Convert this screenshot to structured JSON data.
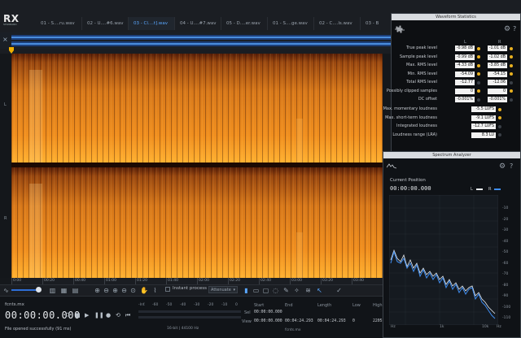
{
  "app": {
    "logo": "RX",
    "logo_sub": "STANDARD"
  },
  "tabs": [
    {
      "label": "01 - S....ru.wav",
      "active": false
    },
    {
      "label": "02 - U....#6.wav",
      "active": false
    },
    {
      "label": "03 - Cl....t].wav",
      "active": true
    },
    {
      "label": "04 - U....#7.wav",
      "active": false
    },
    {
      "label": "05 - D....er.wav",
      "active": false
    },
    {
      "label": "01 - S....ge.wav",
      "active": false
    },
    {
      "label": "02 - C....ls.wav",
      "active": false
    },
    {
      "label": "03 - B",
      "active": false
    }
  ],
  "channels": {
    "left": "L",
    "right": "R"
  },
  "timeline": [
    "0:00",
    "00:20",
    "00:40",
    "01:00",
    "01:20",
    "01:40",
    "02:00",
    "02:20",
    "02:40",
    "03:00",
    "03:20",
    "03:40"
  ],
  "toolbar": {
    "instant_process": "Instant process",
    "attenuate": "Attenuate"
  },
  "bottom": {
    "filename": "fcnts.mx",
    "timecode": "00:00:00.000",
    "status": "File opened successfully (91 ms)",
    "meter_ticks": [
      "-Inf.",
      "-60",
      "-50",
      "-40",
      "-30",
      "-20",
      "-10",
      "0"
    ],
    "bitdepth": "16-bit | 44100 Hz",
    "headers": {
      "start": "Start",
      "end": "End",
      "length": "Length",
      "low": "Low",
      "high": "High"
    },
    "sel_label": "Sel",
    "view_label": "View",
    "sel_start": "00:00:00.000",
    "view_start": "00:00:00.000",
    "view_end": "00:04:24.293",
    "view_length": "00:04:24.293",
    "low_val": "0",
    "high_val": "2205",
    "file_small": "fcnts.mx"
  },
  "waveform_statistics": {
    "title": "Waveform Statistics",
    "col_l": "L",
    "col_r": "R",
    "rows": [
      {
        "label": "True peak level",
        "l": "-0.98 dB",
        "r": "-1.01 dB",
        "dot_l": true,
        "dot_r": true
      },
      {
        "label": "Sample peak level",
        "l": "-0.99 dB",
        "r": "-1.02 dB",
        "dot_l": true,
        "dot_r": true
      },
      {
        "label": "Max. RMS level",
        "l": "-4.33 dB",
        "r": "-3.85 dB",
        "dot_l": true,
        "dot_r": true
      },
      {
        "label": "Min. RMS level",
        "l": "-54.09 dB",
        "r": "-54.15 dB",
        "dot_l": true,
        "dot_r": true
      },
      {
        "label": "Total RMS level",
        "l": "-12.77 dB",
        "r": "-12.06 dB",
        "dot_l": false,
        "dot_r": false
      },
      {
        "label": "Possibly clipped samples",
        "l": "0",
        "r": "0",
        "dot_l": true,
        "dot_r": true
      },
      {
        "label": "DC offset",
        "l": "-0.001%",
        "r": "-0.001%",
        "dot_l": false,
        "dot_r": false
      }
    ],
    "loudness": [
      {
        "label": "Max. momentary loudness",
        "value": "-5.5 LUFS",
        "dot": true
      },
      {
        "label": "Max. short-term loudness",
        "value": "-9.1 LUFS",
        "dot": true
      },
      {
        "label": "Integrated loudness",
        "value": "-12.7 LUFS",
        "dot": false
      },
      {
        "label": "Loudness range (LRA)",
        "value": "8.3 LU",
        "dot": false
      }
    ]
  },
  "spectrum_analyzer": {
    "title": "Spectrum Analyzer",
    "current_position_label": "Current Position",
    "current_position": "00:00:00.000",
    "legend_l": "L",
    "legend_r": "R",
    "color_l": "#e8ecf0",
    "color_r": "#3f8df0",
    "db_ticks": [
      "-10",
      "-20",
      "-30",
      "-40",
      "-50",
      "-60",
      "-70",
      "-80",
      "-90",
      "-100",
      "-110"
    ],
    "hz_ticks": [
      "Hz",
      "1k",
      "10k",
      "Hz"
    ]
  },
  "colors": {
    "accent": "#2e6ed6",
    "active_tab": "#5aa7ff",
    "spectro_hot": "#ff9a1a",
    "spectro_cold": "#3a1006"
  }
}
